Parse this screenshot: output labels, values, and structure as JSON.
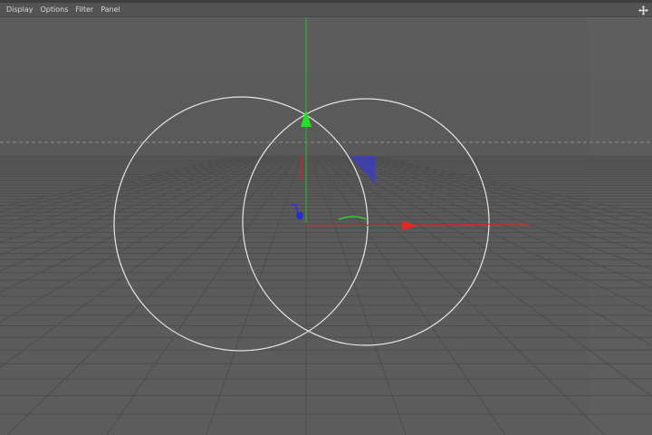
{
  "menubar": {
    "items": [
      {
        "label": "Display"
      },
      {
        "label": "Options"
      },
      {
        "label": "Filter"
      },
      {
        "label": "Panel"
      }
    ]
  },
  "icons": {
    "move": "move-icon"
  },
  "viewport": {
    "camera": "perspective",
    "grid": true,
    "colors": {
      "background": "#5b5b5b",
      "grid_line": "#4e4e4e",
      "circle_spline": "#e8e8e8",
      "axis_x": "#e22020",
      "axis_y": "#21d321",
      "axis_z": "#2626d6",
      "horizon_dashed": "#8c8c8c"
    },
    "objects": [
      {
        "name": "circle-spline-left"
      },
      {
        "name": "circle-spline-right"
      },
      {
        "name": "move-gizmo"
      }
    ]
  }
}
